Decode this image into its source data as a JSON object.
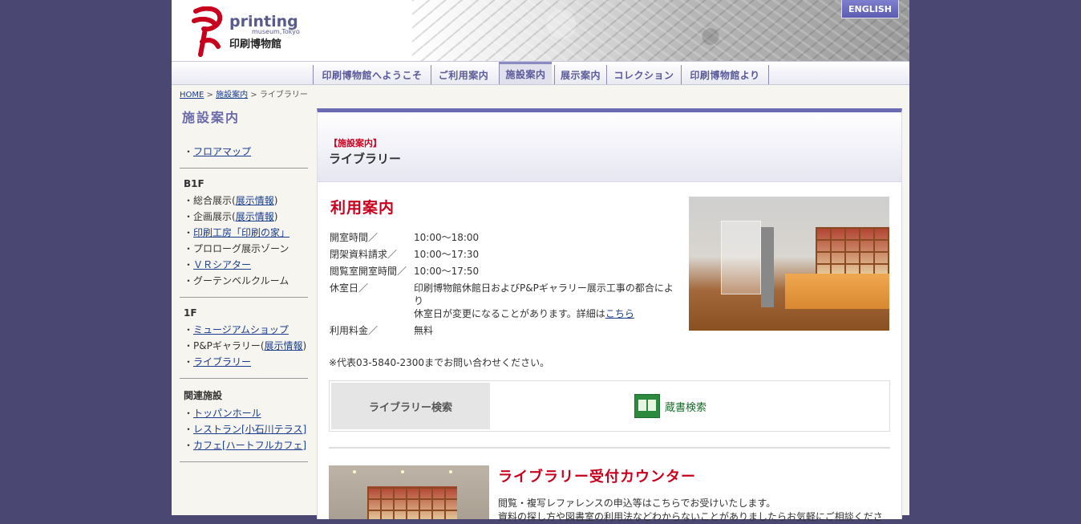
{
  "header": {
    "logo_printing": "printing",
    "logo_museum": "museum,Tokyo",
    "logo_jp": "印刷博物館",
    "english_label": "ENGLISH"
  },
  "nav": {
    "items": [
      {
        "label": "印刷博物館へようこそ"
      },
      {
        "label": "ご利用案内"
      },
      {
        "label": "施設案内"
      },
      {
        "label": "展示案内"
      },
      {
        "label": "コレクション"
      },
      {
        "label": "印刷博物館より"
      }
    ],
    "active_index": 2
  },
  "breadcrumb": {
    "home": "HOME",
    "sep": ">",
    "facility": "施設案内",
    "current": "ライブラリー"
  },
  "sidebar": {
    "title": "施設案内",
    "floor_map": "フロアマップ",
    "b1f": {
      "head": "B1F",
      "general_prefix": "総合展示(",
      "general_link": "展示情報",
      "general_suffix": ")",
      "special_prefix": "企画展示(",
      "special_link": "展示情報",
      "special_suffix": ")",
      "workshop": "印刷工房「印刷の家」",
      "prologue": "プロローグ展示ゾーン",
      "vr": "ＶＲシアター",
      "gutenberg": "グーテンベルクルーム"
    },
    "f1": {
      "head": "1F",
      "shop": "ミュージアムショップ",
      "pp_prefix": "P&Pギャラリー(",
      "pp_link": "展示情報",
      "pp_suffix": ")",
      "library": "ライブラリー"
    },
    "related": {
      "head": "関連施設",
      "hall": "トッパンホール",
      "restaurant": "レストラン[小石川テラス]",
      "cafe": "カフェ[ハートフルカフェ]"
    },
    "bullet": "・"
  },
  "main": {
    "category": "【施設案内】",
    "title": "ライブラリー",
    "usage_title": "利用案内",
    "info": {
      "hours_label": "開室時間／",
      "hours_value": "10:00〜18:00",
      "closed_req_label": "閉架資料請求／",
      "closed_req_value": "10:00〜17:30",
      "reading_label": "閲覧室開室時間／",
      "reading_value": "10:00〜17:50",
      "holiday_label": "休室日／",
      "holiday_value_1": "印刷博物館休館日およびP&Pギャラリー展示工事の都合により",
      "holiday_value_2": "休室日が変更になることがあります。詳細は",
      "holiday_link": "こちら",
      "fee_label": "利用料金／",
      "fee_value": "無料"
    },
    "note": "※代表03-5840-2300までお問い合わせください。",
    "search_label": "ライブラリー検索",
    "search_link": "蔵書検索",
    "counter_title": "ライブラリー受付カウンター",
    "counter_text_1": "閲覧・複写レファレンスの申込等はこちらでお受けいたします。",
    "counter_text_2": "資料の探し方や図書室の利用法などわからないことがありましたらお気軽にご相談くださ"
  },
  "colors": {
    "background": "#4a4873",
    "accent_red": "#c8001e",
    "nav_text": "#5a5a9a",
    "main_border": "#6b6bb3"
  }
}
